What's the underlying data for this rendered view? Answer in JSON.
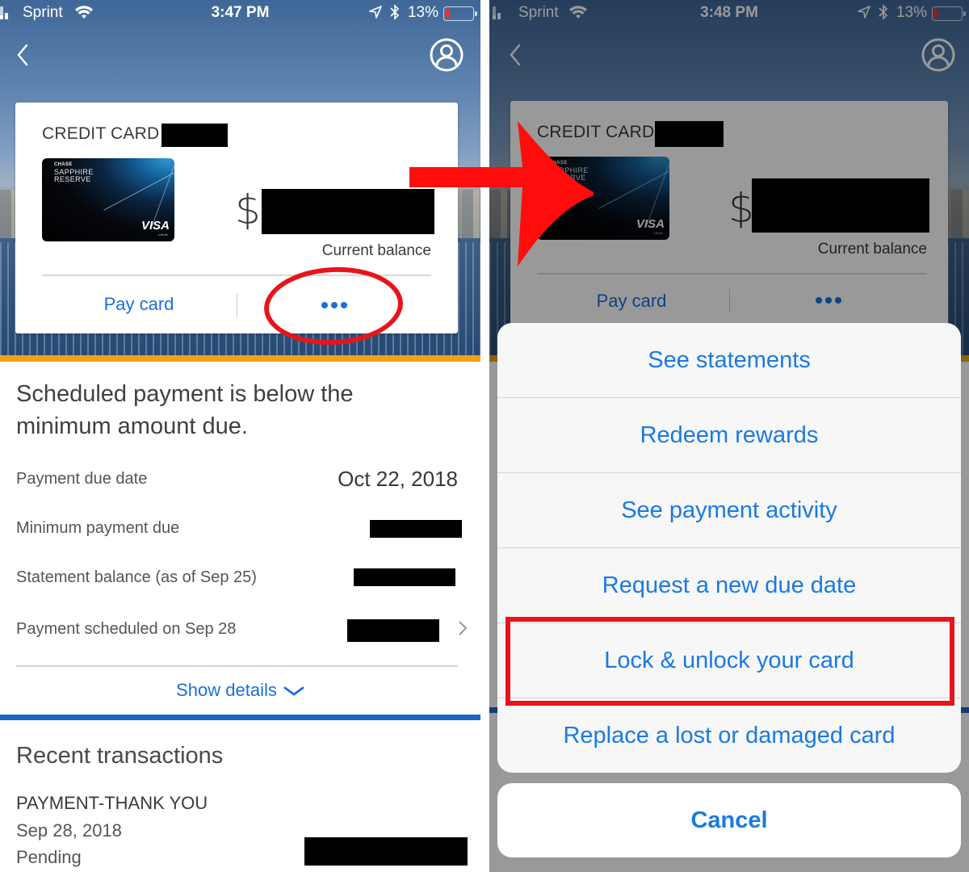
{
  "left_screen": {
    "status_bar": {
      "carrier": "Sprint",
      "time": "3:47 PM",
      "battery_percent": "13%",
      "battery_level": 0.13,
      "signal_bars_active": 2,
      "signal_bars_total": 4,
      "icons": [
        "signal-icon",
        "wifi-icon",
        "location-icon",
        "bluetooth-icon",
        "battery-icon"
      ]
    },
    "nav": {
      "back_icon": "chevron-left-icon",
      "profile_icon": "profile-icon"
    },
    "card_summary": {
      "title": "CREDIT CARD",
      "account_number": "[redacted]",
      "card_image": {
        "issuer": "CHASE",
        "name_line1": "SAPPHIRE",
        "name_line2": "RESERVE",
        "network": "VISA",
        "network_sub": "Infinite"
      },
      "currency_symbol": "$",
      "balance": "[redacted]",
      "balance_label": "Current balance",
      "pay_card_label": "Pay card",
      "more_icon": "more-horizontal-icon"
    },
    "details": {
      "headline": "Scheduled payment is below the minimum amount due.",
      "rows": [
        {
          "label": "Payment due date",
          "value": "Oct 22, 2018"
        },
        {
          "label": "Minimum payment due",
          "value": "[redacted]"
        },
        {
          "label": "Statement balance (as of Sep 25)",
          "value": "[redacted]"
        },
        {
          "label": "Payment scheduled on Sep 28",
          "value": "[redacted]"
        }
      ],
      "show_details_label": "Show details"
    },
    "recent_transactions": {
      "heading": "Recent transactions",
      "items": [
        {
          "description": "PAYMENT-THANK YOU",
          "date": "Sep 28, 2018",
          "status": "Pending",
          "amount": "[redacted]"
        }
      ]
    }
  },
  "right_screen": {
    "status_bar": {
      "carrier": "Sprint",
      "time": "3:48 PM",
      "battery_percent": "13%",
      "battery_level": 0.13
    },
    "card_summary": {
      "title": "CREDIT CARD",
      "account_number": "[redacted]",
      "card_image": {
        "issuer": "CHASE",
        "name_line1": "SAPPHIRE",
        "name_line2": "RESERVE",
        "network": "VISA",
        "network_sub": "Infinite"
      },
      "currency_symbol": "$",
      "balance": "[redacted]",
      "balance_label": "Current balance",
      "pay_card_label": "Pay card"
    },
    "action_sheet": {
      "options": [
        "See statements",
        "Redeem rewards",
        "See payment activity",
        "Request a new due date",
        "Lock & unlock your card",
        "Replace a lost or damaged card"
      ],
      "highlighted_option": "Lock & unlock your card",
      "cancel_label": "Cancel"
    }
  },
  "annotations": {
    "color": "#e8141b",
    "items": [
      "red-ellipse around more button",
      "red arrow from left to right screen",
      "red rectangle around Lock & unlock your card"
    ]
  },
  "colors": {
    "link_blue": "#1a6fdc",
    "ios_blue": "#1a7ae0",
    "accent_orange": "#f4a013",
    "accent_blue": "#1b66c2",
    "annotation_red": "#e8141b"
  }
}
